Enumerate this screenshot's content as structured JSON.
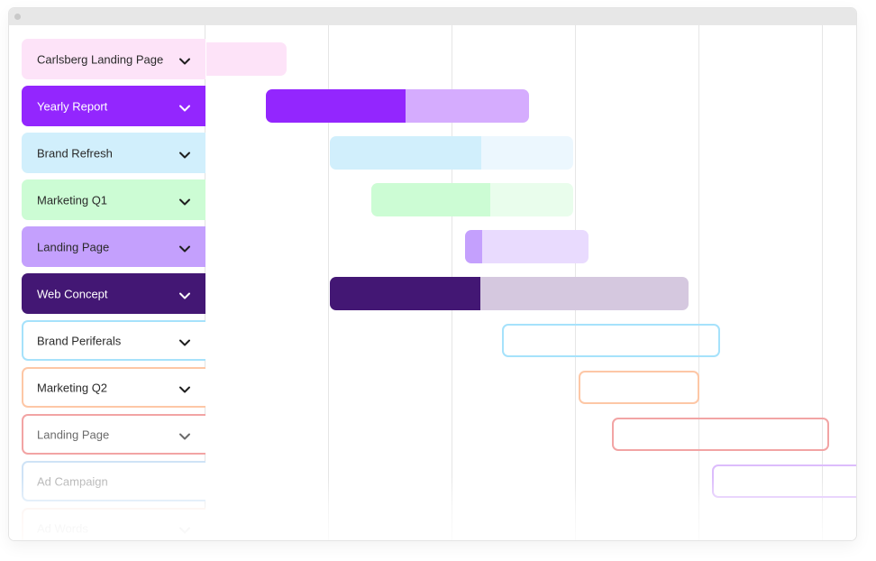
{
  "window": {
    "title": ""
  },
  "timeline": {
    "columns": 6
  },
  "rows": [
    {
      "label": "Carlsberg Landing Page",
      "style": "filled",
      "label_bg": "#fde3f8",
      "text_color": "#2a2a2a",
      "chevron": true,
      "bar": {
        "type": "filled",
        "start": 0.0,
        "end": 0.66,
        "progress": 1.0,
        "done_color": "#fde3f8",
        "rest_color": "#fde3f8",
        "attached": true
      }
    },
    {
      "label": "Yearly Report",
      "style": "filled",
      "label_bg": "#9326fe",
      "text_color": "#ffffff",
      "chevron": true,
      "bar": {
        "type": "filled",
        "start": 0.49,
        "end": 2.62,
        "progress": 0.53,
        "done_color": "#9326fe",
        "rest_color": "#d4a9fe"
      }
    },
    {
      "label": "Brand Refresh",
      "style": "filled",
      "label_bg": "#d1effc",
      "text_color": "#2a2a2a",
      "chevron": true,
      "bar": {
        "type": "filled",
        "start": 1.01,
        "end": 2.98,
        "progress": 0.62,
        "done_color": "#d1effc",
        "rest_color": "#ebf7fe"
      }
    },
    {
      "label": "Marketing Q1",
      "style": "filled",
      "label_bg": "#ccfcd4",
      "text_color": "#2a2a2a",
      "chevron": true,
      "bar": {
        "type": "filled",
        "start": 1.34,
        "end": 2.98,
        "progress": 0.59,
        "done_color": "#ccfcd4",
        "rest_color": "#e8fdeb"
      }
    },
    {
      "label": "Landing Page",
      "style": "filled",
      "label_bg": "#c4a0fd",
      "text_color": "#2a2a2a",
      "chevron": true,
      "bar": {
        "type": "filled",
        "start": 2.1,
        "end": 3.1,
        "progress": 0.14,
        "done_color": "#c4a0fd",
        "rest_color": "#e8dafe"
      }
    },
    {
      "label": "Web Concept",
      "style": "filled",
      "label_bg": "#431774",
      "text_color": "#ffffff",
      "chevron": true,
      "bar": {
        "type": "filled",
        "start": 1.01,
        "end": 3.91,
        "progress": 0.42,
        "done_color": "#431774",
        "rest_color": "#d4c6de"
      }
    },
    {
      "label": "Brand Periferals",
      "style": "outline",
      "border_color": "#a6e2fb",
      "text_color": "#2a2a2a",
      "chevron": true,
      "bar": {
        "type": "outline",
        "start": 2.4,
        "end": 4.17,
        "border_color": "#a6e2fb"
      }
    },
    {
      "label": "Marketing Q2",
      "style": "outline",
      "border_color": "#fdc7a6",
      "text_color": "#2a2a2a",
      "chevron": true,
      "bar": {
        "type": "outline",
        "start": 3.02,
        "end": 4.0,
        "border_color": "#fdc7a6"
      }
    },
    {
      "label": "Landing Page",
      "style": "outline",
      "border_color": "#f2a4a4",
      "text_color": "#6b6b6b",
      "chevron": true,
      "bar": {
        "type": "outline",
        "start": 3.29,
        "end": 5.05,
        "border_color": "#f2a4a4"
      }
    },
    {
      "label": "Ad Campaign",
      "style": "outline",
      "border_color": "#cfe3f6",
      "text_color": "#b4b4b4",
      "chevron": false,
      "bar": {
        "type": "outline",
        "start": 4.1,
        "end": 5.3,
        "border_color": "#dcbcfc"
      }
    },
    {
      "label": "Ad Words",
      "style": "outline",
      "border_color": "#fbece6",
      "text_color": "#e0e0e0",
      "chevron": true,
      "bar": null
    }
  ]
}
